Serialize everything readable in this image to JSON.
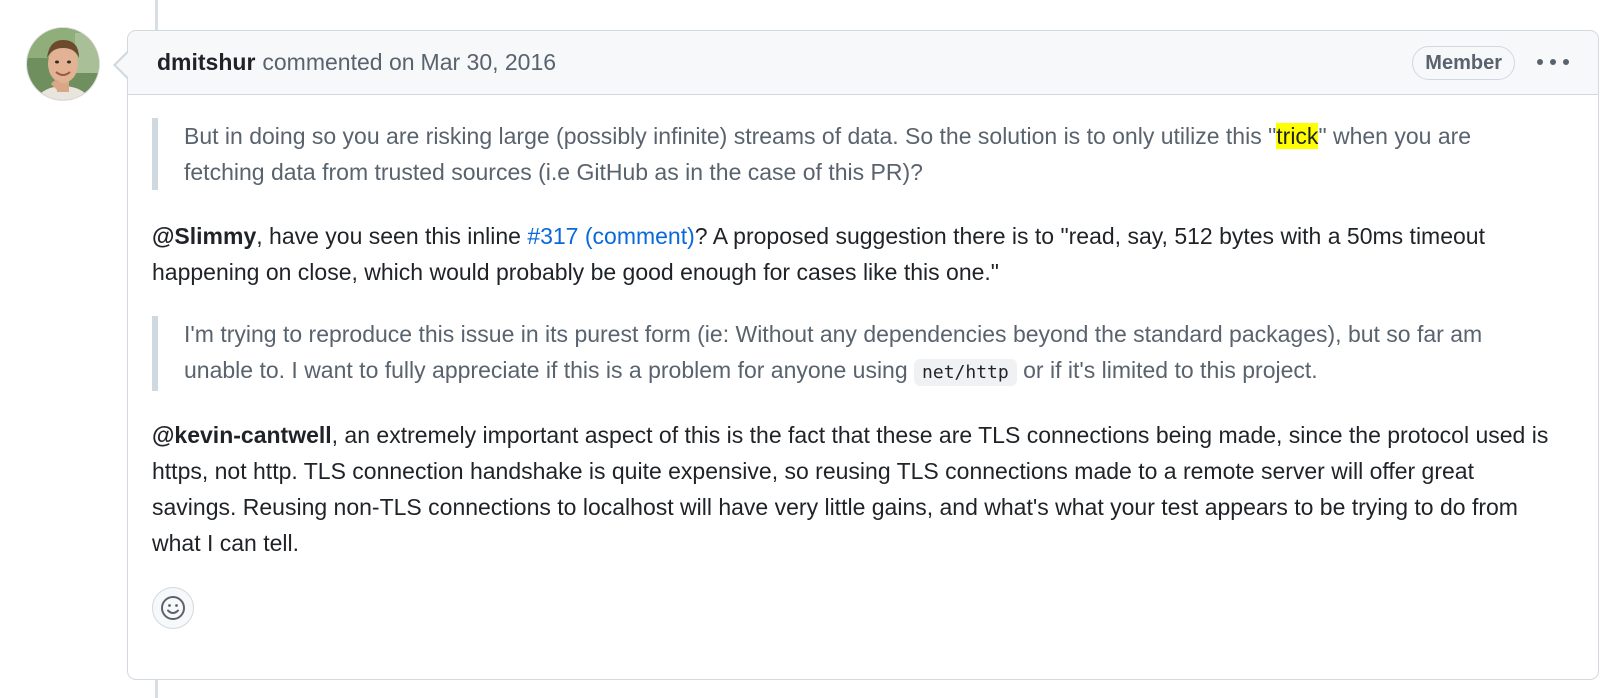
{
  "comment": {
    "author": "dmitshur",
    "action": "commented on",
    "date": "Mar 30, 2016",
    "badge": "Member",
    "menu_icon": "kebab-horizontal-icon",
    "avatar_icon": "user-avatar",
    "reaction_icon": "smiley-icon"
  },
  "body": {
    "quote1": {
      "before": "But in doing so you are risking large (possibly infinite) streams of data. So the solution is to only utilize this \"",
      "highlight": "trick",
      "after": "\" when you are fetching data from trusted sources (i.e GitHub as in the case of this PR)?"
    },
    "para1": {
      "mention": "@Slimmy",
      "text1": ", have you seen this inline ",
      "link": "#317 (comment)",
      "text2": "? A proposed suggestion there is to \"read, say, 512 bytes with a 50ms timeout happening on close, which would probably be good enough for cases like this one.\""
    },
    "quote2": {
      "before": "I'm trying to reproduce this issue in its purest form (ie: Without any dependencies beyond the standard packages), but so far am unable to. I want to fully appreciate if this is a problem for anyone using ",
      "code": "net/http",
      "after": " or if it's limited to this project."
    },
    "para2": {
      "mention": "@kevin-cantwell",
      "text": ", an extremely important aspect of this is the fact that these are TLS connections being made, since the protocol used is https, not http. TLS connection handshake is quite expensive, so reusing TLS connections made to a remote server will offer great savings. Reusing non-TLS connections to localhost will have very little gains, and what's what your test appears to be trying to do from what I can tell."
    }
  },
  "colors": {
    "link": "#0969da",
    "highlight": "#ffff00",
    "border": "#d1d9e0",
    "header_bg": "#f6f8fa",
    "muted_text": "#59636e"
  }
}
